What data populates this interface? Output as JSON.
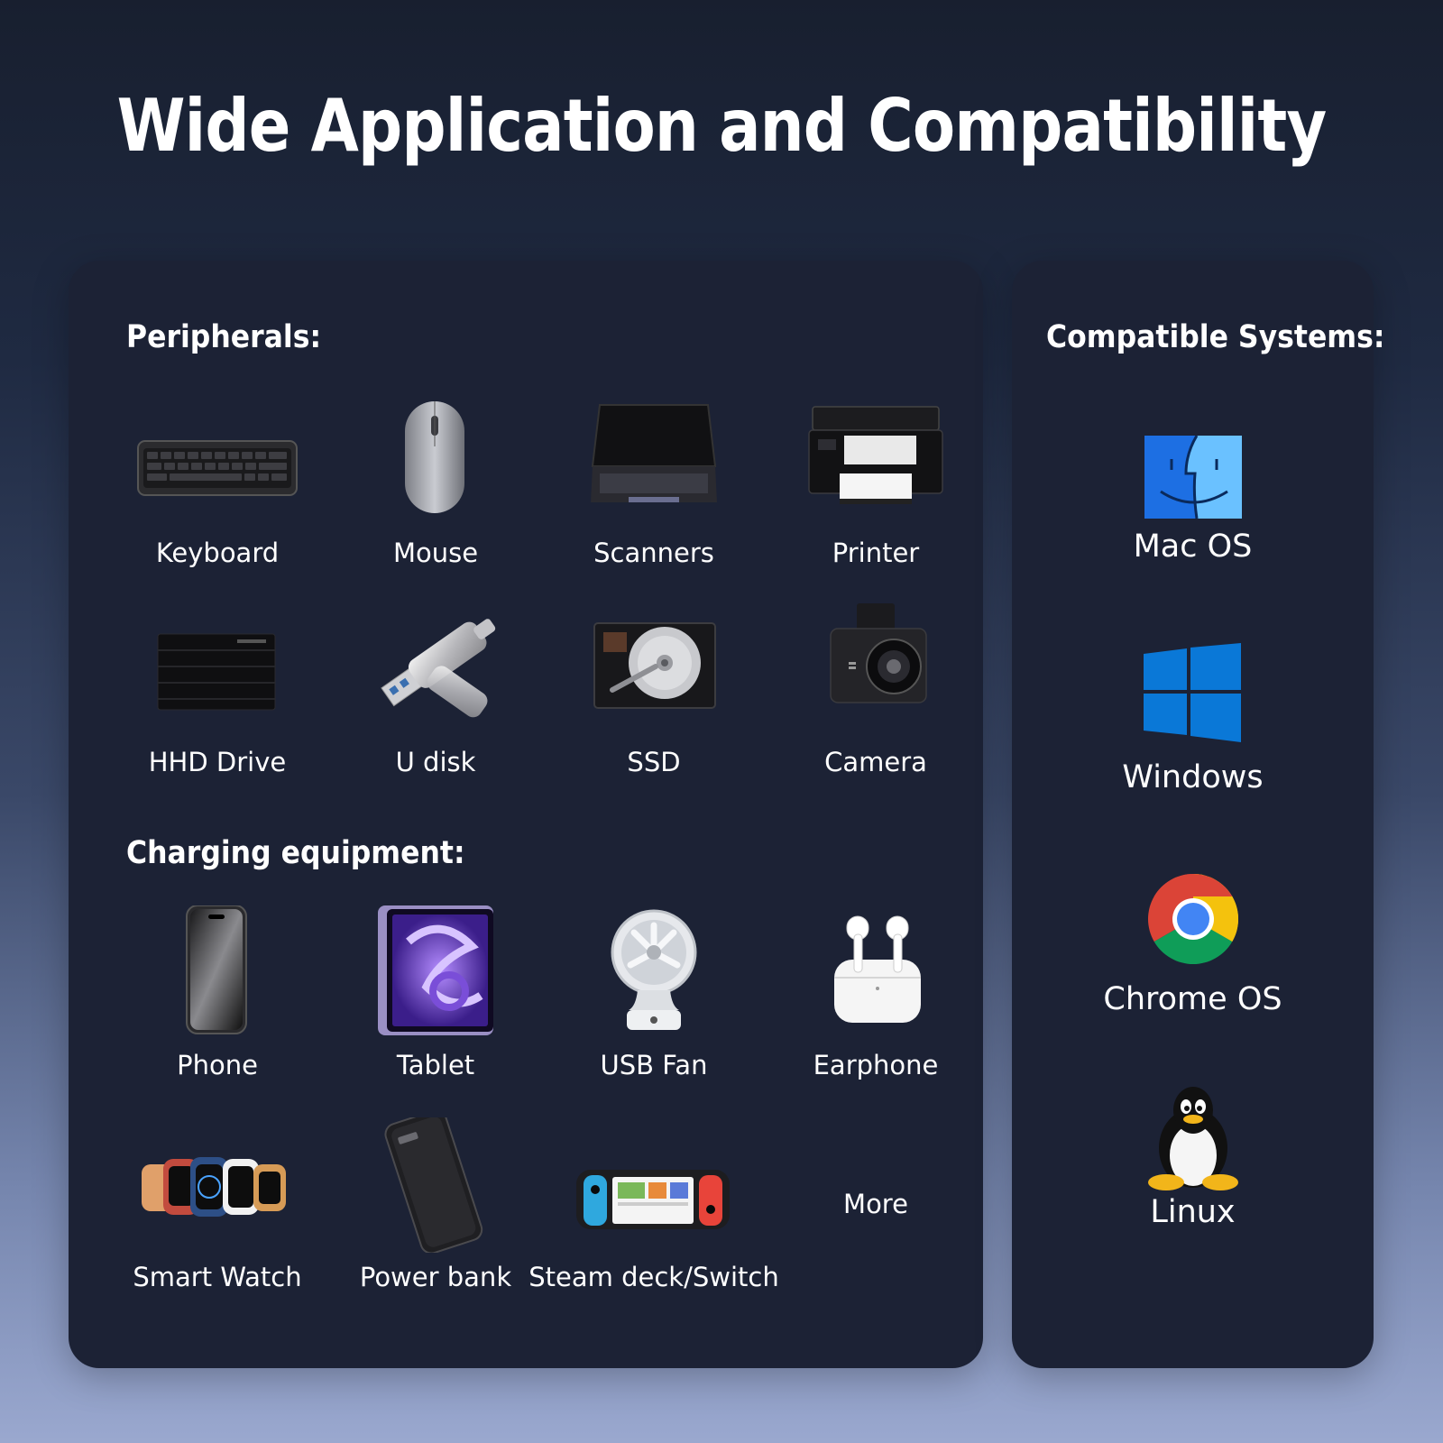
{
  "title": "Wide Application and Compatibility",
  "peripherals": {
    "heading": "Peripherals:",
    "items": [
      {
        "label": "Keyboard",
        "icon": "keyboard-icon"
      },
      {
        "label": "Mouse",
        "icon": "mouse-icon"
      },
      {
        "label": "Scanners",
        "icon": "scanner-icon"
      },
      {
        "label": "Printer",
        "icon": "printer-icon"
      },
      {
        "label": "HHD Drive",
        "icon": "hdd-drive-icon"
      },
      {
        "label": "U disk",
        "icon": "usb-disk-icon"
      },
      {
        "label": "SSD",
        "icon": "ssd-icon"
      },
      {
        "label": "Camera",
        "icon": "dash-camera-icon"
      }
    ]
  },
  "charging": {
    "heading": "Charging equipment:",
    "items": [
      {
        "label": "Phone",
        "icon": "phone-icon"
      },
      {
        "label": "Tablet",
        "icon": "tablet-icon"
      },
      {
        "label": "USB Fan",
        "icon": "usb-fan-icon"
      },
      {
        "label": "Earphone",
        "icon": "earphone-icon"
      },
      {
        "label": "Smart Watch",
        "icon": "smart-watch-icon"
      },
      {
        "label": "Power bank",
        "icon": "power-bank-icon"
      },
      {
        "label": "Steam deck/Switch",
        "icon": "game-console-icon"
      },
      {
        "label": "More"
      }
    ]
  },
  "systems": {
    "heading": "Compatible Systems:",
    "items": [
      {
        "label": "Mac OS",
        "icon": "mac-os-icon"
      },
      {
        "label": "Windows",
        "icon": "windows-icon"
      },
      {
        "label": "Chrome OS",
        "icon": "chrome-os-icon"
      },
      {
        "label": "Linux",
        "icon": "linux-icon"
      }
    ]
  },
  "colors": {
    "panel": "#1c2235",
    "text": "#ffffff",
    "windows_blue": "#0a78d7",
    "chrome_red": "#db4437",
    "chrome_yellow": "#f4c20d",
    "chrome_green": "#0f9d58",
    "chrome_blue": "#4285f4"
  }
}
